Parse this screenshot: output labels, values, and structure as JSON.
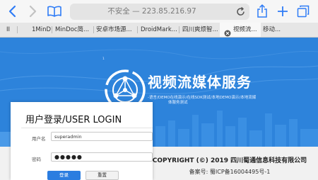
{
  "browser": {
    "address": "不安全 — 223.85.216.97",
    "tabs": [
      {
        "label": "II"
      },
      {
        "label": "1MinD"
      },
      {
        "label": "MinDoc简..."
      },
      {
        "label": "安卓市场源..."
      },
      {
        "label": "DroidMark..."
      },
      {
        "label": "四川爽烦智..."
      },
      {
        "label": "视频流..."
      },
      {
        "label": "移动..."
      }
    ]
  },
  "page": {
    "brand_title": "视频流媒体服务",
    "brand_sub_line1": "-语言/DEMO在线演示/在线SDK测试/本地DEMO演示/本地流媒",
    "brand_sub_line2": "体服务测试",
    "cut_text": "1"
  },
  "login": {
    "title": "用户登录/USER LOGIN",
    "username_label": "用户名",
    "username_value": "superadmin",
    "password_label": "密码",
    "password_value": "●●●●●",
    "login_button": "登录",
    "reset_button": "重置"
  },
  "footer": {
    "copyright": "COPYRIGHT (©) 2019 四川蜀通信息科技有限公司",
    "icp": "备案号: 蜀ICP备16004495号-1"
  },
  "colors": {
    "page_blue": "#2d83db",
    "button_blue": "#2b7de0",
    "safari_blue": "#2f7cf6"
  }
}
